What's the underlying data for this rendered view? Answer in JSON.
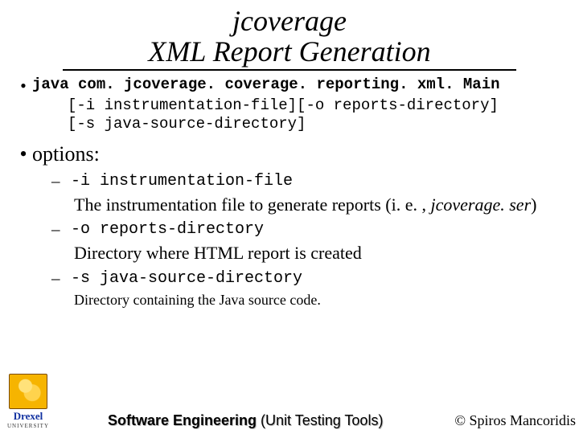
{
  "title": {
    "line1": "jcoverage",
    "line2": "XML Report Generation"
  },
  "command": {
    "main": "java com. jcoverage. coverage. reporting. xml. Main",
    "args1": "[-i instrumentation-file][-o reports-directory]",
    "args2": "[-s java-source-directory]"
  },
  "options_label": "options:",
  "options": [
    {
      "flag": "-i instrumentation-file",
      "desc_pre": "The instrumentation file to generate reports (i. e. , ",
      "desc_em": "jcoverage. ser",
      "desc_post": ")",
      "size": "normal"
    },
    {
      "flag": "-o reports-directory",
      "desc_pre": "Directory where HTML report is created",
      "desc_em": "",
      "desc_post": "",
      "size": "normal"
    },
    {
      "flag": "-s java-source-directory",
      "desc_pre": "Directory containing the Java source code.",
      "desc_em": "",
      "desc_post": "",
      "size": "small"
    }
  ],
  "footer": {
    "logo_name": "Drexel",
    "logo_sub": "UNIVERSITY",
    "center_bold": "Software Engineering ",
    "center_rest": "(Unit Testing Tools)",
    "right": "© Spiros Mancoridis"
  }
}
